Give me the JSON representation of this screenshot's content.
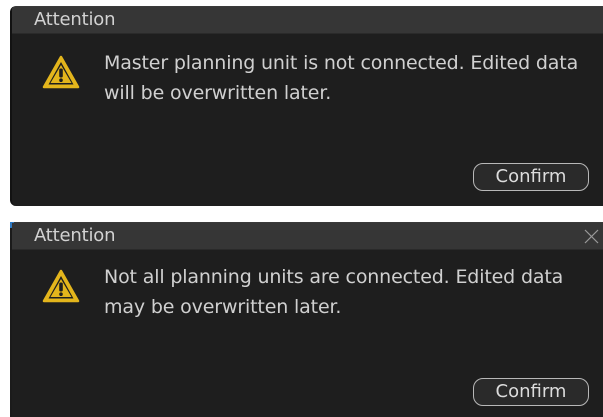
{
  "dialogs": [
    {
      "title": "Attention",
      "icon": "warning-icon",
      "message": "Master planning unit is not connected. Edited data will be overwritten later.",
      "confirm_label": "Confirm",
      "has_close": false
    },
    {
      "title": "Attention",
      "icon": "warning-icon",
      "message": "Not all planning units are connected. Edited data may be overwritten later.",
      "confirm_label": "Confirm",
      "has_close": true,
      "close_icon": "close-icon"
    }
  ],
  "colors": {
    "dialog_bg": "#1e1e1e",
    "title_bar_bg": "#363636",
    "text": "#d0d0d0",
    "warning_fill": "#e3b51c",
    "button_border": "#b8b8b8",
    "accent": "#2f7ac4"
  }
}
